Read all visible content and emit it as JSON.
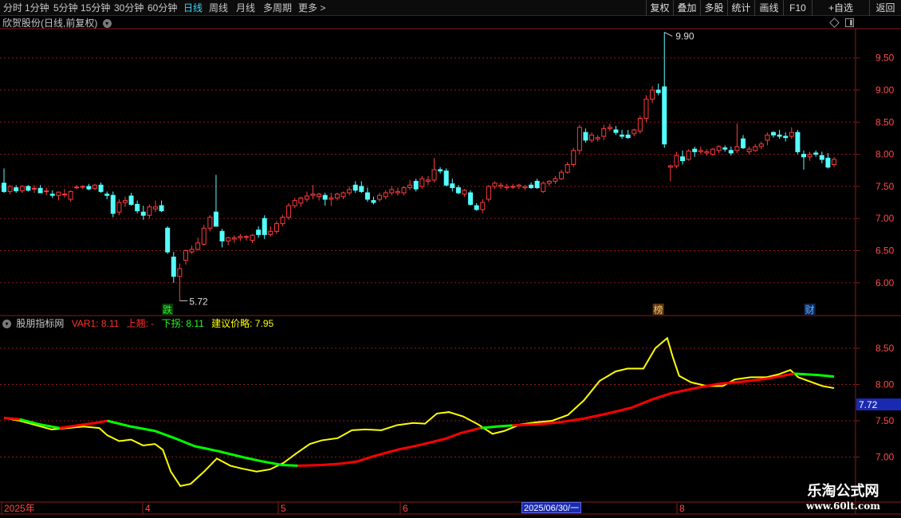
{
  "toolbar": {
    "periods": [
      "分时",
      "1分钟",
      "5分钟",
      "15分钟",
      "30分钟",
      "60分钟",
      "日线",
      "周线",
      "月线",
      "多周期",
      "更多 >"
    ],
    "active_period": "日线",
    "tools": [
      "复权",
      "叠加",
      "多股",
      "统计",
      "画线",
      "F10",
      "+自选",
      "返回"
    ]
  },
  "main_panel": {
    "title": "欣贺股份(日线,前复权)",
    "y_tick_labels": [
      "9.50",
      "9.00",
      "8.50",
      "8.00",
      "7.50",
      "7.00",
      "6.50",
      "6.00"
    ],
    "high_annotation": "9.90",
    "low_annotation": "5.72",
    "markers": [
      "跌",
      "榜",
      "财"
    ]
  },
  "indicator_panel": {
    "name": "股朋指标网",
    "var1_label": "VAR1: 8.11",
    "up_label": "上翘: -",
    "down_label": "下拐: 8.11",
    "advice_label": "建议价略: 7.95",
    "y_tick_labels": [
      "8.50",
      "8.00",
      "7.50",
      "7.00"
    ],
    "current_value_badge": "7.72"
  },
  "x_axis": {
    "labels": [
      "2025年",
      "4",
      "5",
      "6",
      "8"
    ],
    "date_badge": "2025/06/30/一"
  },
  "watermark": {
    "line1": "乐淘公式网",
    "line2": "www.60lt.com"
  },
  "colors": {
    "up_candle": "#ff3c3c",
    "down_candle": "#54ffff",
    "grid": "#8b1a1a",
    "yellow_line": "#ffff00",
    "red_line": "#ff0000",
    "green_line": "#00ff00",
    "active_tab": "#3dd3ff"
  },
  "chart_data": {
    "type": "candlestick",
    "price_ylim": [
      5.6,
      9.95
    ],
    "indicator_ylim": [
      6.55,
      8.9
    ],
    "candles": [
      [
        7.55,
        7.78,
        7.4,
        7.42
      ],
      [
        7.42,
        7.52,
        7.38,
        7.5
      ],
      [
        7.48,
        7.52,
        7.4,
        7.43
      ],
      [
        7.43,
        7.52,
        7.4,
        7.5
      ],
      [
        7.5,
        7.52,
        7.42,
        7.44
      ],
      [
        7.46,
        7.52,
        7.4,
        7.47
      ],
      [
        7.47,
        7.52,
        7.42,
        7.4
      ],
      [
        7.42,
        7.48,
        7.36,
        7.43
      ],
      [
        7.38,
        7.44,
        7.32,
        7.36
      ],
      [
        7.36,
        7.42,
        7.28,
        7.41
      ],
      [
        7.38,
        7.46,
        7.32,
        7.38
      ],
      [
        7.3,
        7.44,
        7.26,
        7.42
      ],
      [
        7.48,
        7.52,
        7.46,
        7.49
      ],
      [
        7.49,
        7.52,
        7.46,
        7.5
      ],
      [
        7.5,
        7.54,
        7.44,
        7.46
      ],
      [
        7.47,
        7.54,
        7.44,
        7.52
      ],
      [
        7.52,
        7.56,
        7.4,
        7.42
      ],
      [
        7.38,
        7.42,
        7.3,
        7.36
      ],
      [
        7.36,
        7.42,
        7.02,
        7.08
      ],
      [
        7.1,
        7.3,
        7.05,
        7.25
      ],
      [
        7.25,
        7.34,
        7.18,
        7.28
      ],
      [
        7.35,
        7.4,
        7.2,
        7.22
      ],
      [
        7.22,
        7.28,
        7.08,
        7.12
      ],
      [
        7.1,
        7.2,
        6.98,
        7.05
      ],
      [
        7.05,
        7.22,
        7.0,
        7.18
      ],
      [
        7.15,
        7.28,
        7.1,
        7.18
      ],
      [
        7.2,
        7.28,
        7.1,
        7.12
      ],
      [
        6.85,
        6.88,
        6.45,
        6.48
      ],
      [
        6.4,
        6.48,
        6.0,
        6.1
      ],
      [
        6.1,
        6.3,
        5.72,
        6.22
      ],
      [
        6.35,
        6.52,
        6.28,
        6.5
      ],
      [
        6.48,
        6.58,
        6.45,
        6.52
      ],
      [
        6.52,
        6.7,
        6.5,
        6.62
      ],
      [
        6.6,
        6.9,
        6.58,
        6.85
      ],
      [
        6.85,
        7.05,
        6.8,
        7.02
      ],
      [
        7.1,
        7.68,
        7.0,
        6.88
      ],
      [
        6.8,
        6.84,
        6.55,
        6.65
      ],
      [
        6.65,
        6.72,
        6.58,
        6.7
      ],
      [
        6.68,
        6.74,
        6.62,
        6.7
      ],
      [
        6.7,
        6.76,
        6.65,
        6.72
      ],
      [
        6.71,
        6.74,
        6.66,
        6.72
      ],
      [
        6.66,
        6.76,
        6.62,
        6.74
      ],
      [
        6.82,
        6.88,
        6.7,
        6.75
      ],
      [
        7.0,
        7.05,
        6.68,
        6.75
      ],
      [
        6.75,
        6.88,
        6.72,
        6.8
      ],
      [
        6.8,
        6.96,
        6.76,
        6.92
      ],
      [
        6.92,
        7.06,
        6.88,
        7.02
      ],
      [
        7.02,
        7.24,
        6.98,
        7.2
      ],
      [
        7.2,
        7.32,
        7.16,
        7.28
      ],
      [
        7.24,
        7.34,
        7.18,
        7.32
      ],
      [
        7.3,
        7.42,
        7.26,
        7.35
      ],
      [
        7.36,
        7.52,
        7.3,
        7.38
      ],
      [
        7.34,
        7.4,
        7.28,
        7.38
      ],
      [
        7.36,
        7.4,
        7.2,
        7.3
      ],
      [
        7.3,
        7.4,
        7.2,
        7.32
      ],
      [
        7.32,
        7.4,
        7.28,
        7.38
      ],
      [
        7.34,
        7.42,
        7.3,
        7.4
      ],
      [
        7.4,
        7.5,
        7.36,
        7.45
      ],
      [
        7.52,
        7.58,
        7.4,
        7.44
      ],
      [
        7.5,
        7.58,
        7.4,
        7.42
      ],
      [
        7.4,
        7.48,
        7.26,
        7.3
      ],
      [
        7.28,
        7.34,
        7.22,
        7.25
      ],
      [
        7.3,
        7.4,
        7.26,
        7.36
      ],
      [
        7.34,
        7.44,
        7.3,
        7.4
      ],
      [
        7.4,
        7.5,
        7.36,
        7.45
      ],
      [
        7.4,
        7.48,
        7.36,
        7.42
      ],
      [
        7.4,
        7.5,
        7.36,
        7.48
      ],
      [
        7.48,
        7.6,
        7.44,
        7.52
      ],
      [
        7.58,
        7.62,
        7.42,
        7.46
      ],
      [
        7.5,
        7.66,
        7.46,
        7.62
      ],
      [
        7.58,
        7.66,
        7.52,
        7.6
      ],
      [
        7.6,
        7.94,
        7.56,
        7.76
      ],
      [
        7.76,
        7.8,
        7.7,
        7.74
      ],
      [
        7.74,
        7.78,
        7.5,
        7.52
      ],
      [
        7.54,
        7.62,
        7.42,
        7.48
      ],
      [
        7.48,
        7.52,
        7.38,
        7.4
      ],
      [
        7.38,
        7.46,
        7.34,
        7.44
      ],
      [
        7.4,
        7.44,
        7.2,
        7.22
      ],
      [
        7.2,
        7.24,
        7.12,
        7.14
      ],
      [
        7.14,
        7.3,
        7.08,
        7.25
      ],
      [
        7.3,
        7.52,
        7.26,
        7.5
      ],
      [
        7.5,
        7.58,
        7.46,
        7.55
      ],
      [
        7.5,
        7.56,
        7.46,
        7.52
      ],
      [
        7.48,
        7.54,
        7.44,
        7.5
      ],
      [
        7.5,
        7.54,
        7.46,
        7.5
      ],
      [
        7.5,
        7.54,
        7.46,
        7.52
      ],
      [
        7.48,
        7.52,
        7.44,
        7.5
      ],
      [
        7.52,
        7.56,
        7.46,
        7.48
      ],
      [
        7.58,
        7.62,
        7.46,
        7.48
      ],
      [
        7.42,
        7.58,
        7.4,
        7.55
      ],
      [
        7.55,
        7.6,
        7.5,
        7.58
      ],
      [
        7.58,
        7.66,
        7.54,
        7.62
      ],
      [
        7.62,
        7.76,
        7.6,
        7.72
      ],
      [
        7.72,
        7.88,
        7.7,
        7.84
      ],
      [
        7.84,
        8.1,
        7.8,
        8.06
      ],
      [
        8.06,
        8.46,
        8.0,
        8.42
      ],
      [
        8.34,
        8.4,
        8.18,
        8.22
      ],
      [
        8.22,
        8.34,
        8.18,
        8.3
      ],
      [
        8.24,
        8.3,
        8.2,
        8.26
      ],
      [
        8.28,
        8.46,
        8.22,
        8.4
      ],
      [
        8.4,
        8.48,
        8.36,
        8.42
      ],
      [
        8.38,
        8.44,
        8.3,
        8.34
      ],
      [
        8.3,
        8.38,
        8.24,
        8.28
      ],
      [
        8.3,
        8.38,
        8.24,
        8.26
      ],
      [
        8.32,
        8.4,
        8.28,
        8.38
      ],
      [
        8.36,
        8.6,
        8.32,
        8.56
      ],
      [
        8.56,
        8.92,
        8.5,
        8.86
      ],
      [
        8.86,
        9.06,
        8.8,
        9.0
      ],
      [
        9.0,
        9.1,
        8.92,
        8.96
      ],
      [
        9.05,
        9.9,
        8.1,
        8.16
      ],
      [
        7.8,
        7.84,
        7.58,
        7.82
      ],
      [
        7.82,
        8.04,
        7.78,
        7.98
      ],
      [
        7.96,
        8.06,
        7.84,
        7.9
      ],
      [
        7.92,
        8.08,
        7.9,
        8.05
      ],
      [
        8.08,
        8.12,
        7.96,
        8.04
      ],
      [
        8.04,
        8.12,
        8.0,
        8.06
      ],
      [
        8.02,
        8.08,
        7.98,
        8.04
      ],
      [
        8.0,
        8.1,
        7.98,
        8.08
      ],
      [
        8.06,
        8.14,
        8.02,
        8.12
      ],
      [
        8.1,
        8.14,
        8.04,
        8.08
      ],
      [
        8.06,
        8.12,
        7.98,
        8.02
      ],
      [
        8.06,
        8.48,
        8.02,
        8.12
      ],
      [
        8.24,
        8.3,
        8.08,
        8.1
      ],
      [
        8.04,
        8.12,
        8.0,
        8.08
      ],
      [
        8.06,
        8.16,
        8.04,
        8.12
      ],
      [
        8.12,
        8.2,
        8.08,
        8.16
      ],
      [
        8.22,
        8.34,
        8.14,
        8.3
      ],
      [
        8.34,
        8.36,
        8.26,
        8.3
      ],
      [
        8.3,
        8.38,
        8.24,
        8.28
      ],
      [
        8.28,
        8.34,
        8.2,
        8.26
      ],
      [
        8.28,
        8.42,
        8.24,
        8.34
      ],
      [
        8.34,
        8.38,
        8.0,
        8.04
      ],
      [
        8.0,
        8.06,
        7.76,
        7.96
      ],
      [
        7.96,
        8.04,
        7.9,
        8.0
      ],
      [
        8.02,
        8.06,
        7.96,
        8.0
      ],
      [
        7.98,
        8.04,
        7.86,
        7.92
      ],
      [
        7.94,
        8.02,
        7.78,
        7.8
      ],
      [
        7.84,
        7.96,
        7.8,
        7.92
      ]
    ],
    "yellow_line": [
      [
        0,
        7.54
      ],
      [
        20,
        7.5
      ],
      [
        40,
        7.44
      ],
      [
        60,
        7.38
      ],
      [
        80,
        7.4
      ],
      [
        100,
        7.42
      ],
      [
        120,
        7.4
      ],
      [
        130,
        7.3
      ],
      [
        145,
        7.22
      ],
      [
        160,
        7.24
      ],
      [
        175,
        7.16
      ],
      [
        190,
        7.18
      ],
      [
        200,
        7.1
      ],
      [
        210,
        6.8
      ],
      [
        222,
        6.6
      ],
      [
        235,
        6.63
      ],
      [
        252,
        6.8
      ],
      [
        268,
        6.98
      ],
      [
        285,
        6.88
      ],
      [
        300,
        6.84
      ],
      [
        318,
        6.8
      ],
      [
        335,
        6.83
      ],
      [
        352,
        6.92
      ],
      [
        368,
        7.05
      ],
      [
        385,
        7.18
      ],
      [
        400,
        7.23
      ],
      [
        420,
        7.26
      ],
      [
        438,
        7.37
      ],
      [
        455,
        7.38
      ],
      [
        475,
        7.37
      ],
      [
        495,
        7.44
      ],
      [
        515,
        7.47
      ],
      [
        530,
        7.46
      ],
      [
        545,
        7.6
      ],
      [
        560,
        7.62
      ],
      [
        578,
        7.56
      ],
      [
        597,
        7.45
      ],
      [
        615,
        7.32
      ],
      [
        630,
        7.36
      ],
      [
        650,
        7.45
      ],
      [
        670,
        7.48
      ],
      [
        690,
        7.5
      ],
      [
        710,
        7.58
      ],
      [
        730,
        7.78
      ],
      [
        750,
        8.05
      ],
      [
        770,
        8.18
      ],
      [
        785,
        8.22
      ],
      [
        805,
        8.22
      ],
      [
        820,
        8.5
      ],
      [
        835,
        8.64
      ],
      [
        842,
        8.38
      ],
      [
        850,
        8.12
      ],
      [
        865,
        8.03
      ],
      [
        885,
        7.98
      ],
      [
        905,
        7.98
      ],
      [
        920,
        8.07
      ],
      [
        940,
        8.1
      ],
      [
        960,
        8.1
      ],
      [
        975,
        8.14
      ],
      [
        990,
        8.2
      ],
      [
        1000,
        8.1
      ],
      [
        1015,
        8.04
      ],
      [
        1030,
        7.98
      ],
      [
        1045,
        7.95
      ]
    ],
    "ma_line": [
      [
        0,
        7.54
      ],
      [
        20,
        7.52
      ],
      [
        45,
        7.45
      ],
      [
        70,
        7.4
      ],
      [
        95,
        7.44
      ],
      [
        115,
        7.47
      ],
      [
        130,
        7.5
      ],
      [
        160,
        7.42
      ],
      [
        190,
        7.36
      ],
      [
        215,
        7.26
      ],
      [
        240,
        7.15
      ],
      [
        270,
        7.08
      ],
      [
        300,
        7.0
      ],
      [
        325,
        6.94
      ],
      [
        350,
        6.89
      ],
      [
        370,
        6.88
      ],
      [
        400,
        6.89
      ],
      [
        425,
        6.91
      ],
      [
        445,
        6.94
      ],
      [
        465,
        7.01
      ],
      [
        495,
        7.1
      ],
      [
        525,
        7.17
      ],
      [
        555,
        7.25
      ],
      [
        575,
        7.33
      ],
      [
        600,
        7.4
      ],
      [
        620,
        7.42
      ],
      [
        645,
        7.44
      ],
      [
        670,
        7.45
      ],
      [
        700,
        7.48
      ],
      [
        730,
        7.53
      ],
      [
        760,
        7.6
      ],
      [
        790,
        7.68
      ],
      [
        815,
        7.79
      ],
      [
        840,
        7.88
      ],
      [
        870,
        7.95
      ],
      [
        900,
        8.01
      ],
      [
        930,
        8.04
      ],
      [
        960,
        8.08
      ],
      [
        980,
        8.12
      ],
      [
        995,
        8.15
      ],
      [
        1010,
        8.14
      ],
      [
        1025,
        8.13
      ],
      [
        1045,
        8.11
      ]
    ],
    "ma_segment_colors": [
      {
        "from": 0,
        "to": 20,
        "color": "red"
      },
      {
        "from": 20,
        "to": 70,
        "color": "green"
      },
      {
        "from": 70,
        "to": 130,
        "color": "red"
      },
      {
        "from": 130,
        "to": 370,
        "color": "green"
      },
      {
        "from": 370,
        "to": 600,
        "color": "red"
      },
      {
        "from": 600,
        "to": 640,
        "color": "green"
      },
      {
        "from": 640,
        "to": 995,
        "color": "red"
      },
      {
        "from": 995,
        "to": 1045,
        "color": "green"
      }
    ]
  }
}
